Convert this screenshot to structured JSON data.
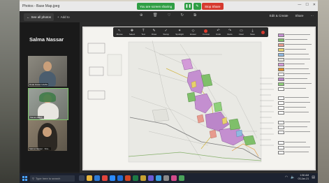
{
  "window": {
    "title": "Photos - Base Map.jpeg",
    "controls": [
      "—",
      "☐",
      "✕"
    ]
  },
  "screenshare": {
    "status": "You are screen sharing",
    "stop_label": "Stop Share",
    "icons": [
      "pause-icon",
      "annotate-icon"
    ]
  },
  "command_bar": {
    "see_all": "See all photos",
    "add_to": "Add to",
    "edit_create": "Edit & Create",
    "share": "Share"
  },
  "video_panel": {
    "presenter": "Salma Nassar",
    "participants": [
      {
        "name": "Doaa Hasan Hoahe"
      },
      {
        "name": "Manal Abdel..."
      },
      {
        "name": "Salma Nassar - Vice..."
      }
    ]
  },
  "annotation_toolbar": [
    {
      "label": "Mouse",
      "icon": "↖"
    },
    {
      "label": "Select",
      "icon": "✥"
    },
    {
      "label": "Text",
      "icon": "T"
    },
    {
      "label": "Draw",
      "icon": "✎"
    },
    {
      "label": "Stamp",
      "icon": "✓"
    },
    {
      "label": "Spotlight",
      "icon": "✶"
    },
    {
      "label": "Eraser",
      "icon": "◇"
    },
    {
      "label": "Format",
      "icon": "●"
    },
    {
      "label": "Undo",
      "icon": "↶"
    },
    {
      "label": "Redo",
      "icon": "↷"
    },
    {
      "label": "Clear",
      "icon": "▭"
    },
    {
      "label": "Save",
      "icon": "⤓"
    }
  ],
  "taskbar": {
    "search_placeholder": "Type here to search",
    "time": "1:56 AM",
    "date": "03-Jan-21"
  },
  "colors": {
    "share_green": "#2f9e44",
    "stop_red": "#d63a2f",
    "taskbar": "#1c2230"
  }
}
